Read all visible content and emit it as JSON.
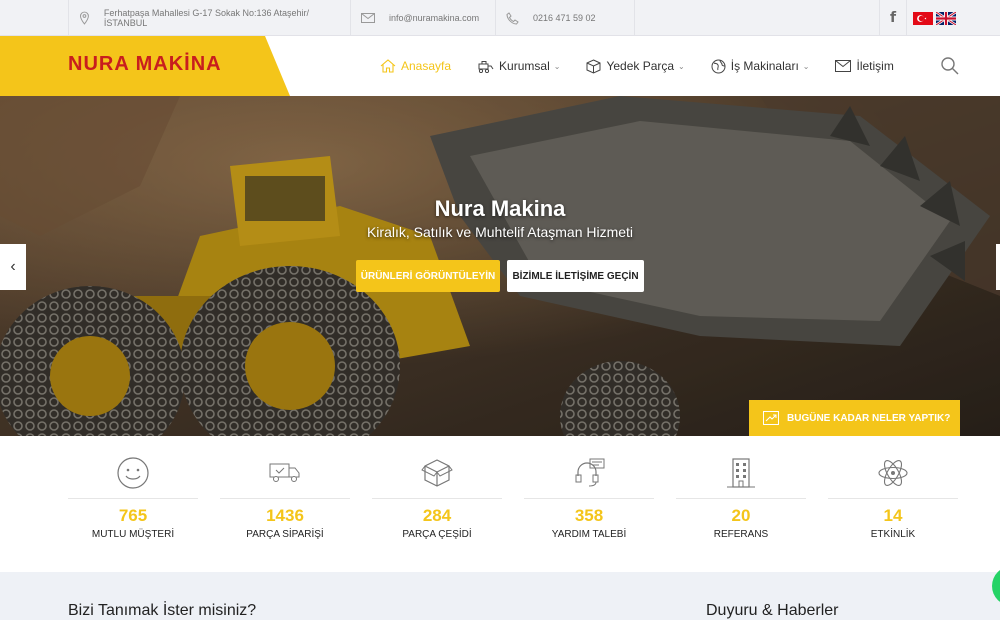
{
  "topbar": {
    "address": "Ferhatpaşa Mahallesi G-17 Sokak No:136 Ataşehir/İSTANBUL",
    "email": "info@nuramakina.com",
    "phone": "0216 471 59 02",
    "facebook_label": "f"
  },
  "brand": {
    "logo": "NURA MAKİNA",
    "accent_color": "#f4c51a",
    "logo_color": "#c81e1e"
  },
  "nav": {
    "items": [
      {
        "label": "Anasayfa",
        "icon": "home-icon",
        "active": true
      },
      {
        "label": "Kurumsal",
        "icon": "machine-icon",
        "dropdown": true
      },
      {
        "label": "Yedek Parça",
        "icon": "box-icon",
        "dropdown": true
      },
      {
        "label": "İş Makinaları",
        "icon": "globe-icon",
        "dropdown": true
      },
      {
        "label": "İletişim",
        "icon": "mail-icon"
      }
    ]
  },
  "hero": {
    "title": "Nura Makina",
    "subtitle": "Kiralık, Satılık ve Muhtelif Ataşman Hizmeti",
    "btn_primary": "ÜRÜNLERİ GÖRÜNTÜLEYİN",
    "btn_secondary": "BİZİMLE İLETİŞİME GEÇİN",
    "badge": "BUGÜNE KADAR NELER YAPTIK?"
  },
  "stats": [
    {
      "value": "765",
      "label": "MUTLU MÜŞTERİ",
      "icon": "smile-icon"
    },
    {
      "value": "1436",
      "label": "PARÇA SİPARİŞİ",
      "icon": "truck-icon"
    },
    {
      "value": "284",
      "label": "PARÇA ÇEŞİDİ",
      "icon": "package-icon"
    },
    {
      "value": "358",
      "label": "YARDIM TALEBİ",
      "icon": "headset-icon"
    },
    {
      "value": "20",
      "label": "REFERANS",
      "icon": "building-icon"
    },
    {
      "value": "14",
      "label": "ETKİNLİK",
      "icon": "atom-icon"
    }
  ],
  "sections": {
    "about_title": "Bizi Tanımak İster misiniz?",
    "news_title": "Duyuru & Haberler"
  }
}
